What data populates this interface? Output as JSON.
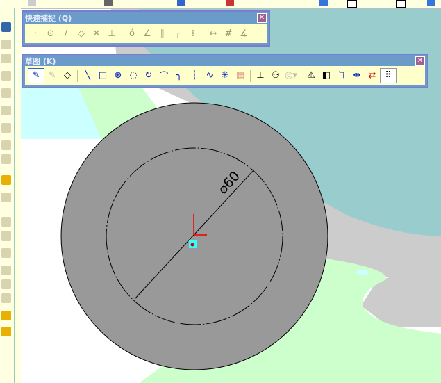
{
  "snap_toolbar": {
    "title": "快速捕捉 (Q)",
    "close": "✕",
    "icons": [
      "point-snap",
      "center-snap",
      "midpoint-snap",
      "quadrant-snap",
      "intersection-snap",
      "nearest-snap",
      "tangent-snap",
      "perpendicular-snap",
      "parallel-snap",
      "horizontal-vertical-snap",
      "grid-corner-snap",
      "length-snap",
      "grid-snap",
      "angle-snap"
    ]
  },
  "sketch_toolbar": {
    "title": "草图 (K)",
    "close": "✕",
    "icons": [
      "sketch",
      "3d-sketch",
      "smart-dimension",
      "line",
      "rectangle",
      "circle",
      "perimeter-circle",
      "centerpoint-arc",
      "3-point-arc",
      "tangent-arc",
      "centerline",
      "spline",
      "point",
      "sketch-picture",
      "add-relation",
      "display-relations",
      "offset",
      "mirror",
      "convert-entities",
      "trim",
      "extend",
      "move-entities",
      "rapid-snaps"
    ]
  },
  "drawing": {
    "dimension_label": "⌀60",
    "colors": {
      "part": "#999999",
      "teal": "#99cccc",
      "gray": "#cccccc",
      "green": "#ccffcc",
      "cyan": "#ccffff"
    }
  }
}
